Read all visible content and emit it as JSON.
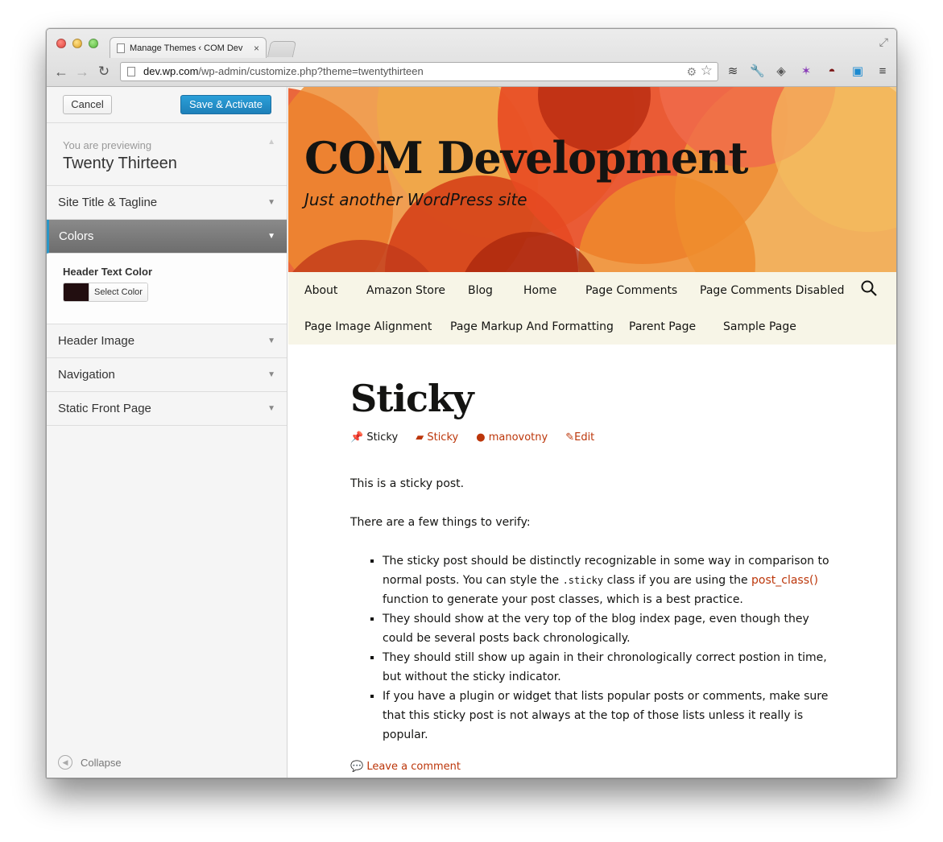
{
  "browser": {
    "tab_title": "Manage Themes ‹ COM Dev",
    "tab_close": "×",
    "url_host": "dev.wp.com",
    "url_path": "/wp-admin/customize.php?theme=twentythirteen"
  },
  "customizer": {
    "cancel_label": "Cancel",
    "save_label": "Save & Activate",
    "previewing_label": "You are previewing",
    "theme_name": "Twenty Thirteen",
    "sections": {
      "site_title": "Site Title & Tagline",
      "colors": "Colors",
      "header_image": "Header Image",
      "navigation": "Navigation",
      "static_front": "Static Front Page"
    },
    "header_text_color_label": "Header Text Color",
    "select_color_label": "Select Color",
    "header_text_color": "#220e10",
    "collapse_label": "Collapse"
  },
  "site": {
    "title": "COM Development",
    "description": "Just another WordPress site",
    "menu": [
      "About",
      "Amazon Store",
      "Blog",
      "Home",
      "Page Comments",
      "Page Comments Disabled",
      "Page Image Alignment",
      "Page Markup And Formatting",
      "Parent Page",
      "Sample Page"
    ]
  },
  "post": {
    "title": "Sticky",
    "meta_sticky": "Sticky",
    "meta_category": "Sticky",
    "meta_author": "manovotny",
    "meta_edit": "Edit",
    "p1": "This is a sticky post.",
    "p2": "There are a few things to verify:",
    "li1_a": "The sticky post should be distinctly recognizable in some way in comparison to normal posts. You can style the ",
    "li1_code": ".sticky",
    "li1_b": " class if you are using the ",
    "li1_link": "post_class()",
    "li1_c": " function to generate your post classes, which is a best practice.",
    "li2": "They should show at the very top of the blog index page, even though they could be several posts back chronologically.",
    "li3": "They should still show up again in their chronologically correct postion in time, but without the sticky indicator.",
    "li4": "If you have a plugin or widget that lists popular posts or comments, make sure that this sticky post is not always at the top of those lists unless it really is popular.",
    "leave_comment": "Leave a comment"
  },
  "colors": {
    "link": "#bc360a",
    "accent": "#2a95c5"
  }
}
